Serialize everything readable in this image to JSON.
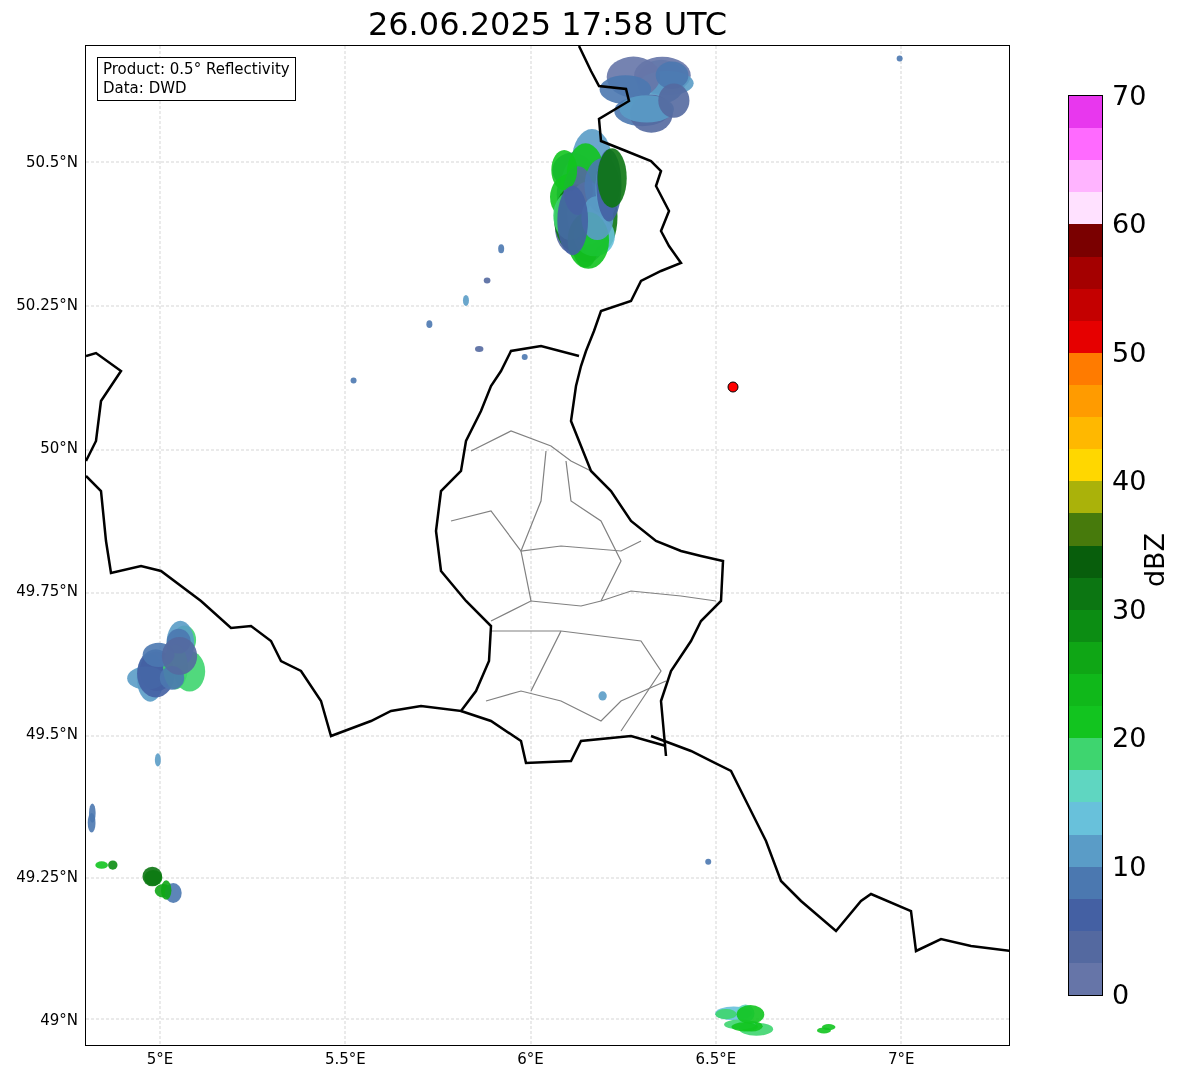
{
  "title": "26.06.2025 17:58 UTC",
  "legend": {
    "lines": [
      "Product: 0.5° Reflectivity",
      "Data: DWD"
    ]
  },
  "y_ticks": [
    "50.5°N",
    "50.25°N",
    "50°N",
    "49.75°N",
    "49.5°N",
    "49.25°N",
    "49°N"
  ],
  "x_ticks": [
    "5°E",
    "5.5°E",
    "6°E",
    "6.5°E",
    "7°E"
  ],
  "colorbar": {
    "label": "dBZ",
    "ticks": [
      "70",
      "60",
      "50",
      "40",
      "30",
      "20",
      "10",
      "0"
    ],
    "segments": [
      {
        "color": "#e837ee"
      },
      {
        "color": "#ff6aff"
      },
      {
        "color": "#ffb4ff"
      },
      {
        "color": "#ffe1ff"
      },
      {
        "color": "#7a0000"
      },
      {
        "color": "#a40000"
      },
      {
        "color": "#c40000"
      },
      {
        "color": "#e60000"
      },
      {
        "color": "#ff7b00"
      },
      {
        "color": "#ff9b00"
      },
      {
        "color": "#ffb800"
      },
      {
        "color": "#ffd700"
      },
      {
        "color": "#aab20a"
      },
      {
        "color": "#477a0c"
      },
      {
        "color": "#085e0c"
      },
      {
        "color": "#0c7612"
      },
      {
        "color": "#0c8d13"
      },
      {
        "color": "#0fa615"
      },
      {
        "color": "#10b81a"
      },
      {
        "color": "#12c41f"
      },
      {
        "color": "#3ed56f"
      },
      {
        "color": "#5fd6c1"
      },
      {
        "color": "#68c1db"
      },
      {
        "color": "#5a9cc7"
      },
      {
        "color": "#4b78b0"
      },
      {
        "color": "#4460a3"
      },
      {
        "color": "#5469a0"
      },
      {
        "color": "#6675a8"
      }
    ]
  }
}
